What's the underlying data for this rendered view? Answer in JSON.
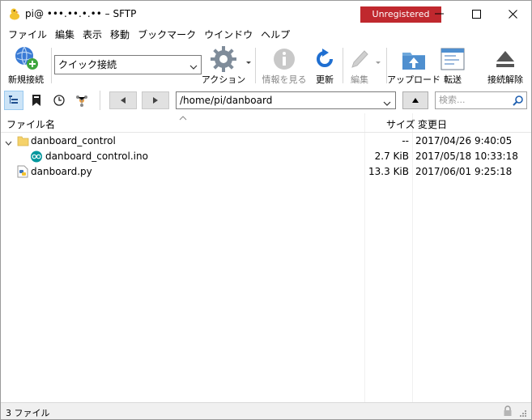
{
  "window": {
    "title": "pi@ •••.••.•.•• – SFTP",
    "badge": "Unregistered"
  },
  "menu": [
    "ファイル",
    "編集",
    "表示",
    "移動",
    "ブックマーク",
    "ウインドウ",
    "ヘルプ"
  ],
  "toolbar": {
    "new_connection": "新規接続",
    "quick_connect": "クイック接続",
    "action": "アクション",
    "info": "情報を見る",
    "refresh": "更新",
    "edit": "編集",
    "upload": "アップロード",
    "transfer": "転送",
    "disconnect": "接続解除"
  },
  "navbar": {
    "path": "/home/pi/danboard",
    "search_placeholder": "検索..."
  },
  "columns": {
    "name": "ファイル名",
    "size": "サイズ",
    "modified": "変更日"
  },
  "files": [
    {
      "name": "danboard_control",
      "size": "--",
      "modified": "2017/04/26 9:40:05",
      "icon": "folder-icon"
    },
    {
      "name": "danboard_control.ino",
      "size": "2.7 KiB",
      "modified": "2017/05/18 10:33:18",
      "icon": "arduino-file-icon"
    },
    {
      "name": "danboard.py",
      "size": "13.3 KiB",
      "modified": "2017/06/01 9:25:18",
      "icon": "python-file-icon"
    }
  ],
  "status": {
    "text": "3 ファイル"
  }
}
